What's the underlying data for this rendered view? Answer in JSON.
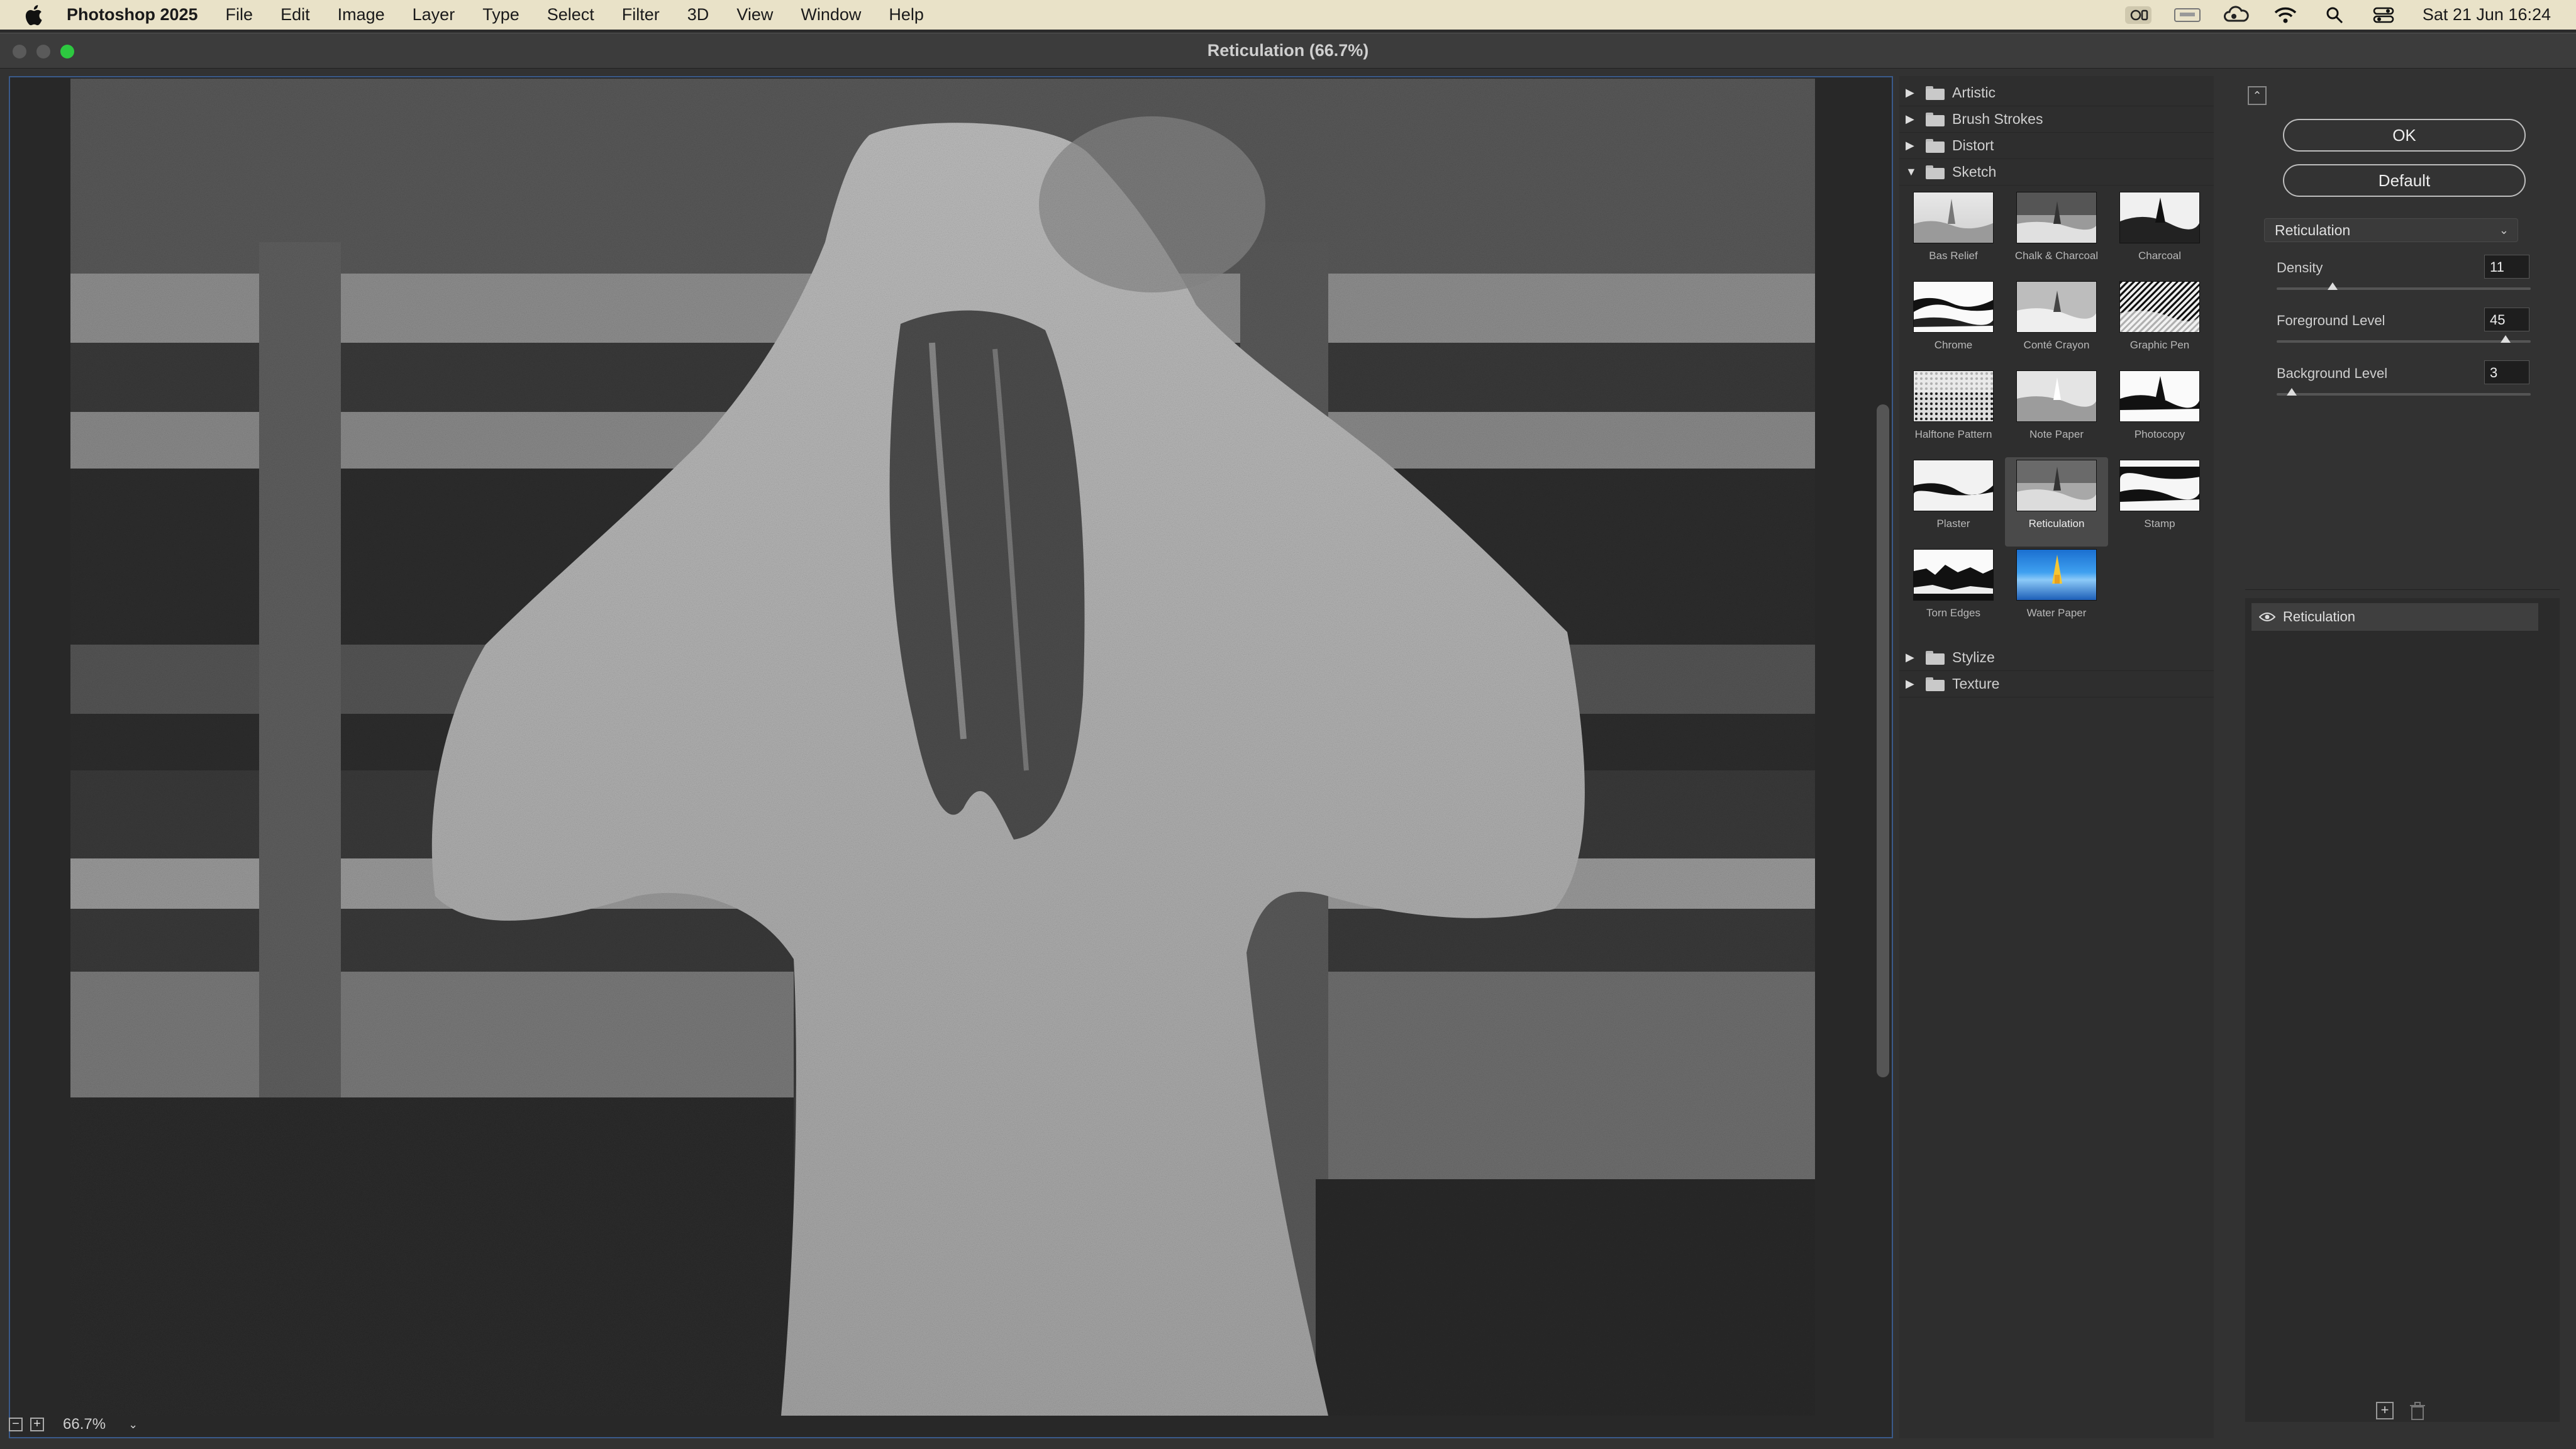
{
  "menubar": {
    "app_name": "Photoshop 2025",
    "items": [
      "File",
      "Edit",
      "Image",
      "Layer",
      "Type",
      "Select",
      "Filter",
      "3D",
      "View",
      "Window",
      "Help"
    ],
    "clock": "Sat 21 Jun  16:24"
  },
  "window": {
    "title": "Reticulation (66.7%)"
  },
  "preview": {
    "zoom": "66.7%"
  },
  "gallery": {
    "categories_top": [
      {
        "label": "Artistic",
        "expanded": false
      },
      {
        "label": "Brush Strokes",
        "expanded": false
      },
      {
        "label": "Distort",
        "expanded": false
      },
      {
        "label": "Sketch",
        "expanded": true
      }
    ],
    "sketch_filters": [
      {
        "label": "Bas Relief",
        "selected": false
      },
      {
        "label": "Chalk & Charcoal",
        "selected": false
      },
      {
        "label": "Charcoal",
        "selected": false
      },
      {
        "label": "Chrome",
        "selected": false
      },
      {
        "label": "Conté Crayon",
        "selected": false
      },
      {
        "label": "Graphic Pen",
        "selected": false
      },
      {
        "label": "Halftone Pattern",
        "selected": false
      },
      {
        "label": "Note Paper",
        "selected": false
      },
      {
        "label": "Photocopy",
        "selected": false
      },
      {
        "label": "Plaster",
        "selected": false
      },
      {
        "label": "Reticulation",
        "selected": true
      },
      {
        "label": "Stamp",
        "selected": false
      },
      {
        "label": "Torn Edges",
        "selected": false
      },
      {
        "label": "Water Paper",
        "selected": false
      }
    ],
    "categories_bottom": [
      {
        "label": "Stylize",
        "expanded": false
      },
      {
        "label": "Texture",
        "expanded": false
      }
    ]
  },
  "settings": {
    "ok_label": "OK",
    "default_label": "Default",
    "filter_select": "Reticulation",
    "params": [
      {
        "label": "Density",
        "value": "11",
        "fraction": 0.22
      },
      {
        "label": "Foreground Level",
        "value": "45",
        "fraction": 0.9
      },
      {
        "label": "Background Level",
        "value": "3",
        "fraction": 0.06
      }
    ],
    "layer_name": "Reticulation"
  }
}
